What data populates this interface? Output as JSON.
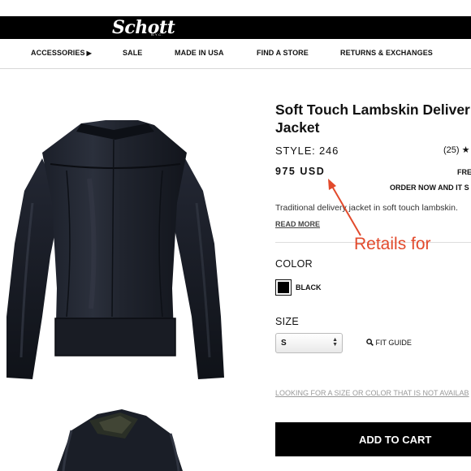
{
  "header": {
    "brand": "Schott",
    "brand_sub": "N.Y.C."
  },
  "nav": {
    "items": [
      "ACCESSORIES",
      "SALE",
      "MADE IN USA",
      "FIND A STORE",
      "RETURNS & EXCHANGES"
    ],
    "accessories_caret": "▶"
  },
  "product": {
    "title_line1": "Soft Touch Lambskin Deliver",
    "title_line2": "Jacket",
    "style": "STYLE: 246",
    "rating": "(25)",
    "rating_star": "★",
    "price": "975 USD",
    "free_text": "FRE",
    "order_text": "ORDER NOW AND IT S",
    "description": "Traditional delivery jacket in soft touch lambskin.",
    "read_more": "READ MORE",
    "color_label": "COLOR",
    "color_name": "BLACK",
    "size_label": "SIZE",
    "size_value": "S",
    "fit_guide": "FIT GUIDE",
    "not_available": "LOOKING FOR A SIZE OR COLOR THAT IS NOT AVAILAB",
    "add_to_cart": "ADD TO CART"
  },
  "annotation": {
    "text": "Retails for",
    "color": "#e24a2c"
  },
  "icons": {
    "search": "magnifier-icon",
    "star": "star-icon",
    "select_arrows": "updown-arrows-icon"
  }
}
